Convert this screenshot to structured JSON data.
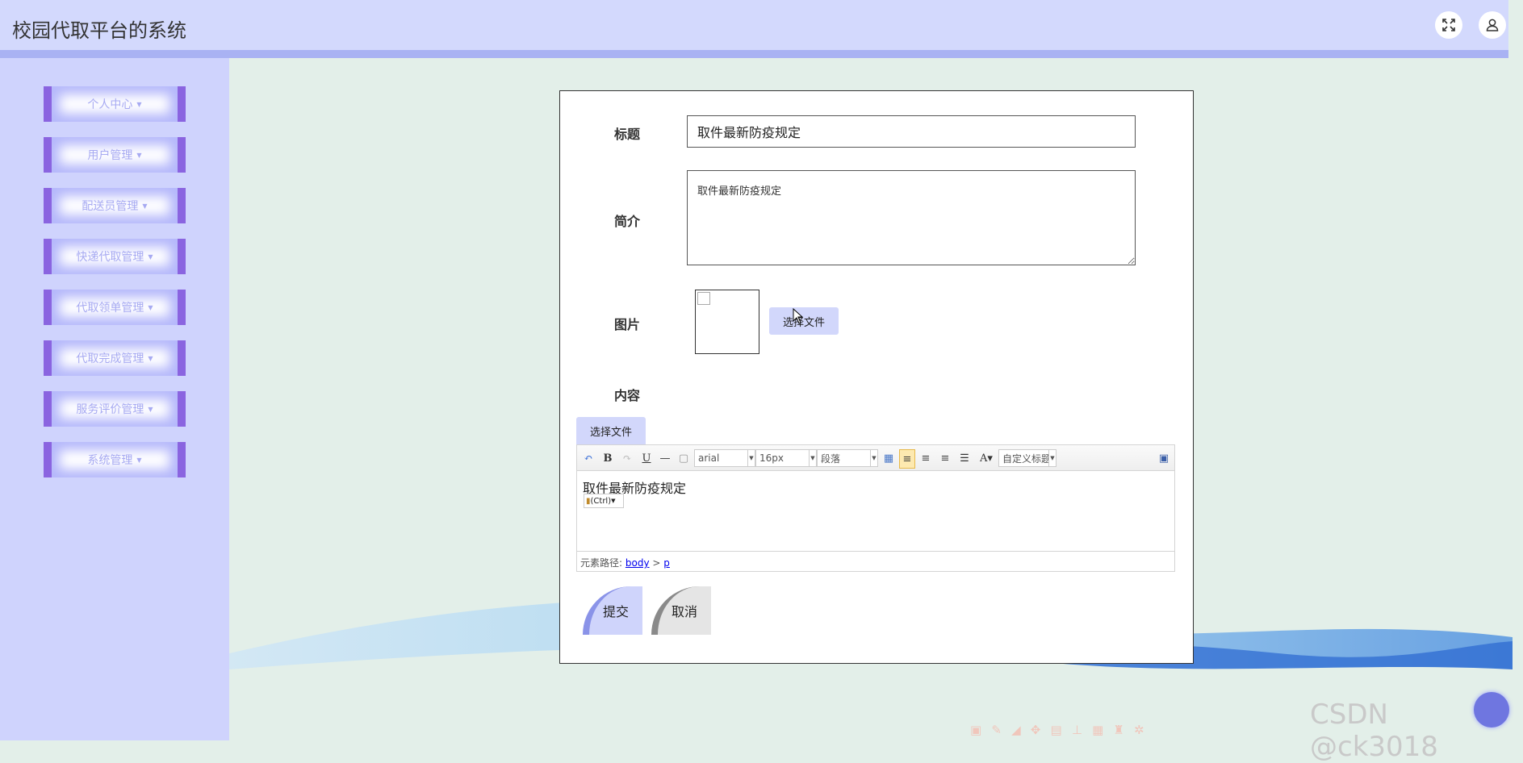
{
  "header": {
    "title": "校园代取平台的系统",
    "icons": [
      "fullscreen-icon",
      "user-icon"
    ]
  },
  "sidebar": {
    "items": [
      {
        "label": "个人中心"
      },
      {
        "label": "用户管理"
      },
      {
        "label": "配送员管理"
      },
      {
        "label": "快递代取管理"
      },
      {
        "label": "代取领单管理"
      },
      {
        "label": "代取完成管理"
      },
      {
        "label": "服务评价管理"
      },
      {
        "label": "系统管理"
      }
    ]
  },
  "form": {
    "title_label": "标题",
    "title_value": "取件最新防疫规定",
    "intro_label": "简介",
    "intro_value": "取件最新防疫规定",
    "image_label": "图片",
    "image_button": "选择文件",
    "content_label": "内容",
    "content_file_button": "选择文件"
  },
  "editor": {
    "font_family": "arial",
    "font_size": "16px",
    "paragraph": "段落",
    "custom_title": "自定义标题",
    "content": "取件最新防疫规定",
    "paste_hint": "(Ctrl)",
    "path_label": "元素路径:",
    "path_body": "body",
    "path_sep": ">",
    "path_p": "p"
  },
  "actions": {
    "submit": "提交",
    "cancel": "取消"
  },
  "watermark": "CSDN @ck3018",
  "colors": {
    "header_bg": "#d3d9fd",
    "sidebar_bg": "#cfd3fd",
    "menu_accent": "#8a64e0",
    "content_bg": "#e3efe9"
  }
}
